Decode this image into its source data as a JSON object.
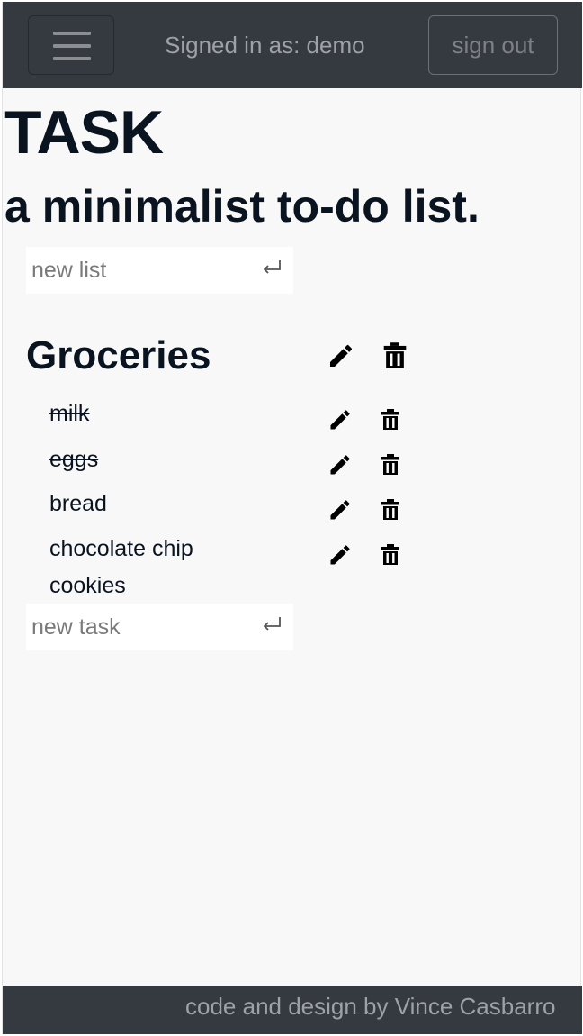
{
  "navbar": {
    "signed_in_text": "Signed in as: demo",
    "sign_out_label": "sign out"
  },
  "header": {
    "title": "TASK",
    "subtitle": "a minimalist to-do list."
  },
  "new_list": {
    "placeholder": "new list",
    "value": ""
  },
  "list": {
    "title": "Groceries",
    "tasks": [
      {
        "label": "milk",
        "done": true
      },
      {
        "label": "eggs",
        "done": true
      },
      {
        "label": "bread",
        "done": false
      },
      {
        "label": "chocolate chip cookies",
        "done": false
      }
    ]
  },
  "new_task": {
    "placeholder": "new task",
    "value": ""
  },
  "footer": {
    "credit": "code and design by Vince Casbarro"
  },
  "icons": {
    "menu": "hamburger-icon",
    "enter": "enter-icon",
    "edit": "pencil-icon",
    "delete": "trash-icon"
  },
  "colors": {
    "navbar_bg": "#343a40",
    "page_bg": "#f8f8f8",
    "text": "#0a1420",
    "muted": "#9ea2a6"
  }
}
